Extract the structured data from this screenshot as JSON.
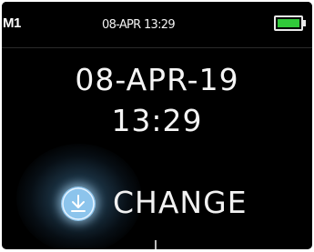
{
  "status_bar": {
    "left_label": "M1",
    "datetime": "08-APR 13:29",
    "battery_icon": "battery-full-icon",
    "battery_color": "#31c93a",
    "battery_level": 1.0
  },
  "main": {
    "date": "08-APR-19",
    "time": "13:29"
  },
  "change_button": {
    "icon": "download-arrow-icon",
    "label": "CHANGE"
  }
}
